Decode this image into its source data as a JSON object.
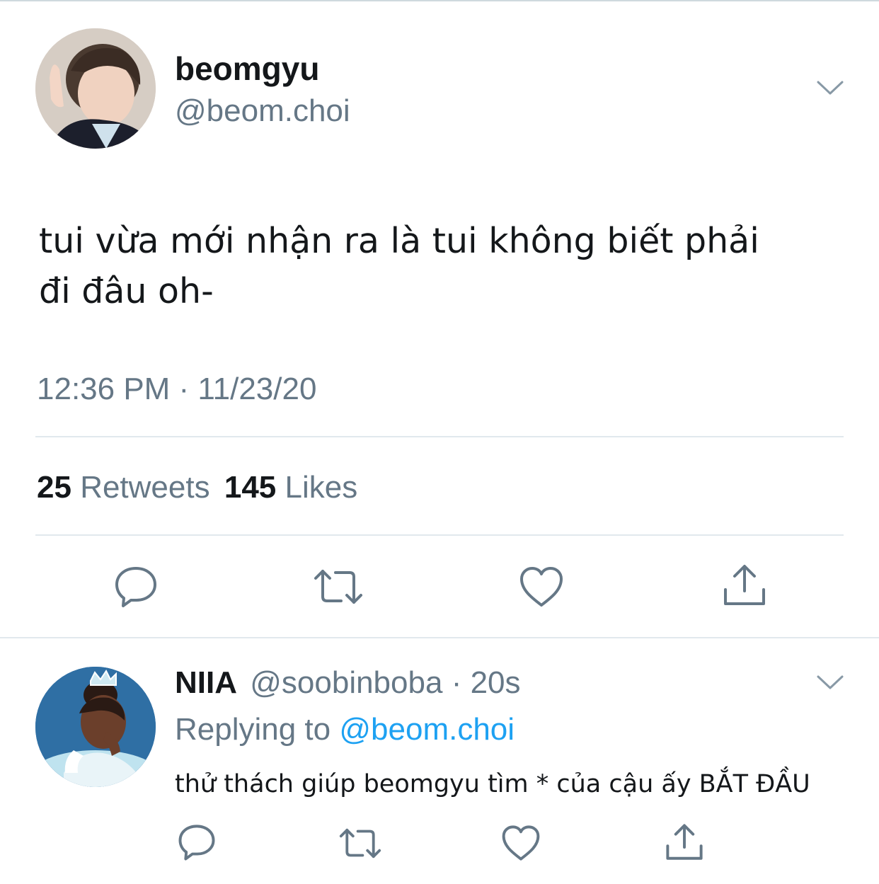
{
  "tweet": {
    "author_name": "beomgyu",
    "author_handle": "@beom.choi",
    "text_line1": "tui vừa mới nhận ra là tui không biết phải",
    "text_line2": "đi đâu oh-",
    "timestamp": "12:36 PM · 11/23/20",
    "retweets_count": "25",
    "retweets_label": "Retweets",
    "likes_count": "145",
    "likes_label": "Likes"
  },
  "reply": {
    "author_name": "NIIA",
    "author_handle": "@soobinboba",
    "separator": "·",
    "time_ago": "20s",
    "replying_prefix": "Replying to",
    "replying_handle": "@beom.choi",
    "text": "thử thách giúp beomgyu tìm * của cậu ấy BẮT ĐẦU"
  },
  "icons": {
    "reply": "reply-bubble-icon",
    "retweet": "retweet-icon",
    "like": "heart-icon",
    "share": "share-icon",
    "menu": "chevron-down-icon"
  },
  "colors": {
    "text_primary": "#14171a",
    "text_secondary": "#657786",
    "link": "#1da1f2",
    "divider": "#e1e8ed",
    "icon": "#657786"
  }
}
